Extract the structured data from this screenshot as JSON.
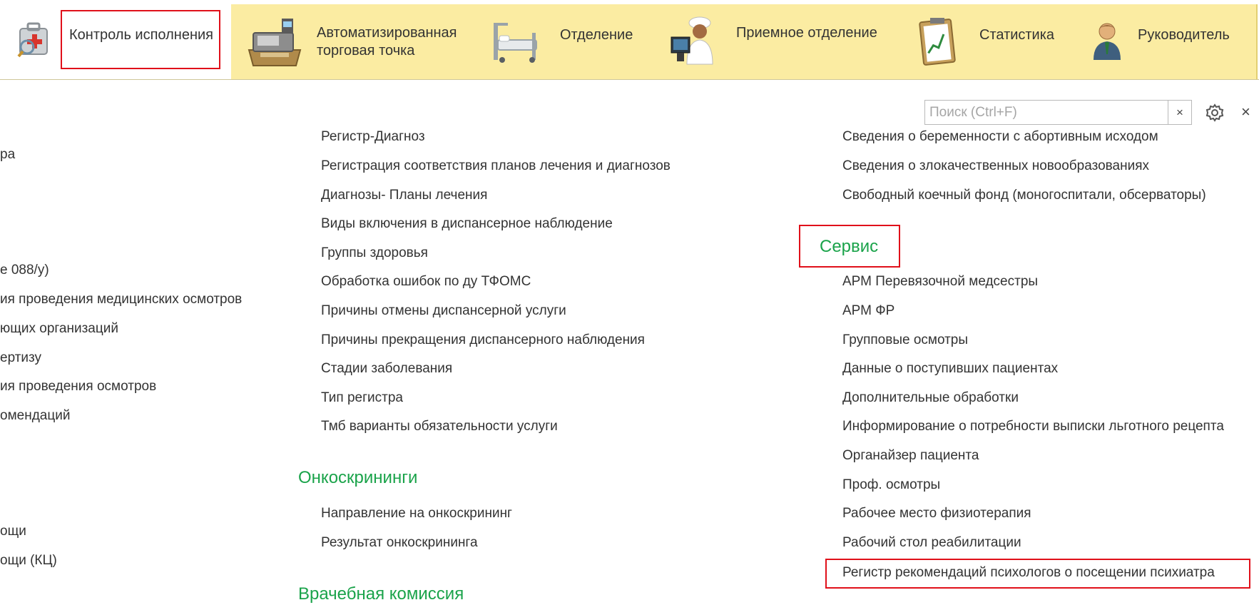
{
  "sections": [
    {
      "label": "Контроль исполнения",
      "icon": "medical-kit-search-icon"
    },
    {
      "label": "Автоматизированная\nторговая точка",
      "icon": "cash-register-icon"
    },
    {
      "label": "Отделение",
      "icon": "hospital-bed-icon"
    },
    {
      "label": "Приемное отделение",
      "icon": "doctor-at-computer-icon"
    },
    {
      "label": "Статистика",
      "icon": "clipboard-chart-icon"
    },
    {
      "label": "Руководитель",
      "icon": "manager-person-icon"
    }
  ],
  "search": {
    "placeholder": "Поиск (Ctrl+F)",
    "clear": "×"
  },
  "window": {
    "close": "×"
  },
  "left_column": [
    "ра",
    "е 088/у)",
    "ия проведения медицинских осмотров",
    "ющих организаций",
    "ертизу",
    "ия проведения осмотров",
    "омендаций",
    "ощи",
    "ощи (КЦ)"
  ],
  "middle_column": {
    "items": [
      "Регистр-Диагноз",
      "Регистрация соответствия планов лечения и диагнозов",
      "Диагнозы- Планы лечения",
      "Виды включения в диспансерное наблюдение",
      "Группы здоровья",
      "Обработка ошибок по ду ТФОМС",
      "Причины отмены диспансерной услуги",
      "Причины прекращения диспансерного наблюдения",
      "Стадии заболевания",
      "Тип регистра",
      "Тмб варианты обязательности услуги"
    ],
    "group_oncoscreening": "Онкоскрининги",
    "oncoscreening_items": [
      "Направление на онкоскрининг",
      "Результат онкоскрининга"
    ],
    "group_cut": "Врачебная комиссия"
  },
  "right_column": {
    "items_top": [
      "Сведения о беременности с абортивным исходом",
      "Сведения о злокачественных новообразованиях",
      "Свободный коечный фонд (моногоспитали, обсерваторы)"
    ],
    "group_service": "Сервис",
    "service_items": [
      "АРМ Перевязочной медсестры",
      "АРМ ФР",
      "Групповые осмотры",
      "Данные о поступивших пациентах",
      "Дополнительные обработки",
      "Информирование о потребности выписки льготного рецепта",
      "Органайзер пациента",
      "Проф. осмотры",
      "Рабочее место физиотерапия",
      "Рабочий стол реабилитации",
      "Регистр рекомендаций психологов о посещении психиатра"
    ]
  },
  "colors": {
    "topbar": "#fbeca2",
    "group_header": "#1aa34a",
    "highlight": "#e0101a",
    "text": "#333333"
  }
}
